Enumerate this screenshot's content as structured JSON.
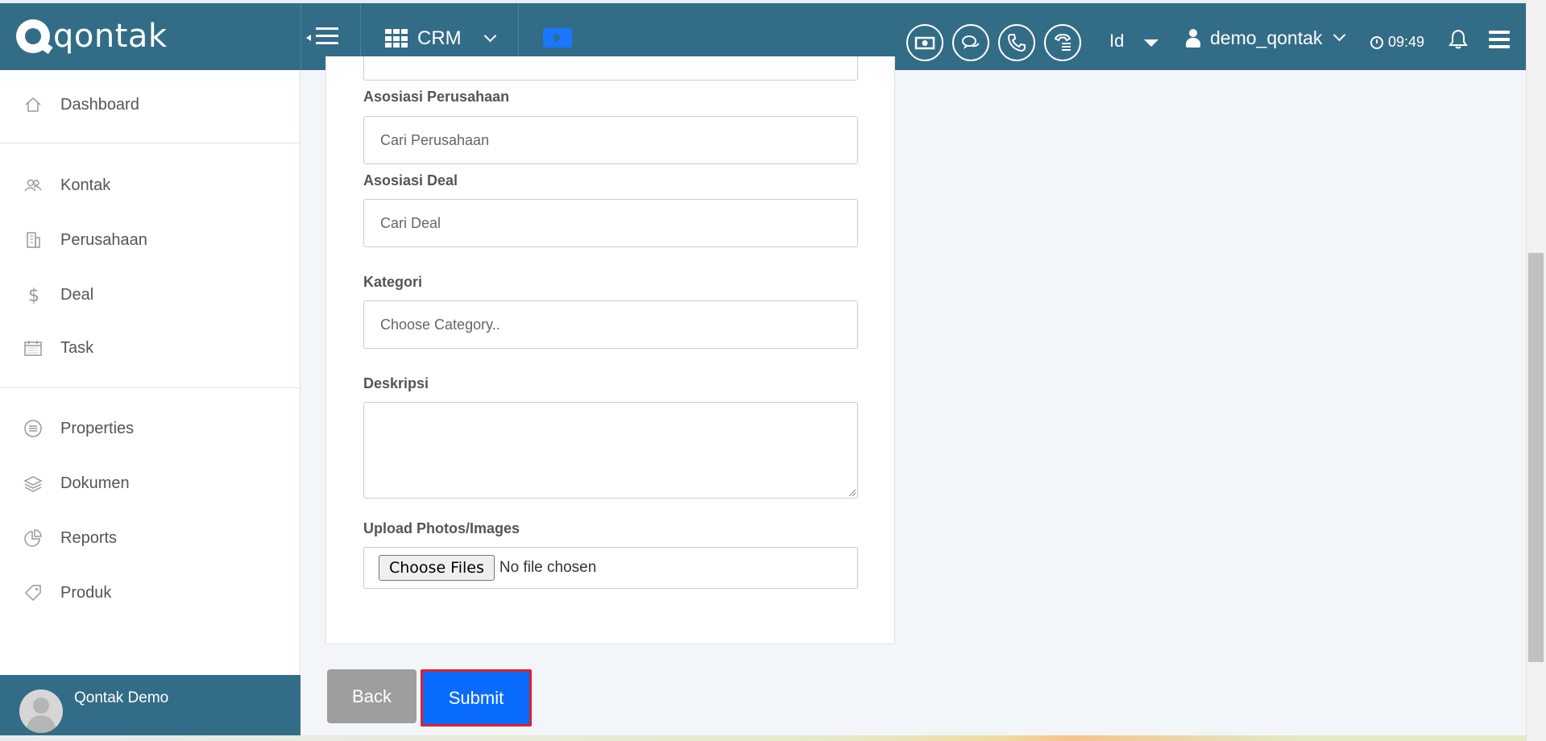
{
  "header": {
    "brand": "qontak",
    "app_menu_label": "CRM",
    "language": "Id",
    "username": "demo_qontak",
    "time": "09:49"
  },
  "header_icons": [
    "hamburger-icon",
    "apps-grid-icon",
    "video-icon",
    "money-icon",
    "chat-icon",
    "phone-icon",
    "call-log-icon",
    "user-icon",
    "clock-icon",
    "bell-icon",
    "menu-icon"
  ],
  "sidebar": {
    "items": [
      {
        "label": "Dashboard",
        "icon": "home-icon"
      },
      {
        "label": "Kontak",
        "icon": "people-icon"
      },
      {
        "label": "Perusahaan",
        "icon": "building-icon"
      },
      {
        "label": "Deal",
        "icon": "dollar-icon"
      },
      {
        "label": "Task",
        "icon": "calendar-icon"
      },
      {
        "label": "Properties",
        "icon": "list-icon"
      },
      {
        "label": "Dokumen",
        "icon": "layers-icon"
      },
      {
        "label": "Reports",
        "icon": "pie-chart-icon"
      },
      {
        "label": "Produk",
        "icon": "tag-icon"
      }
    ],
    "footer_user": "Qontak Demo"
  },
  "form": {
    "company_label": "Asosiasi Perusahaan",
    "company_placeholder": "Cari Perusahaan",
    "deal_label": "Asosiasi Deal",
    "deal_placeholder": "Cari Deal",
    "category_label": "Kategori",
    "category_placeholder": "Choose Category..",
    "description_label": "Deskripsi",
    "description_value": "",
    "upload_label": "Upload Photos/Images",
    "choose_files_label": "Choose Files",
    "no_file_text": "No file chosen"
  },
  "actions": {
    "back_label": "Back",
    "submit_label": "Submit"
  },
  "colors": {
    "header_bg": "#336c87",
    "accent": "#0a6cff",
    "highlight_border": "#e0202a",
    "back_button": "#9e9e9e"
  }
}
